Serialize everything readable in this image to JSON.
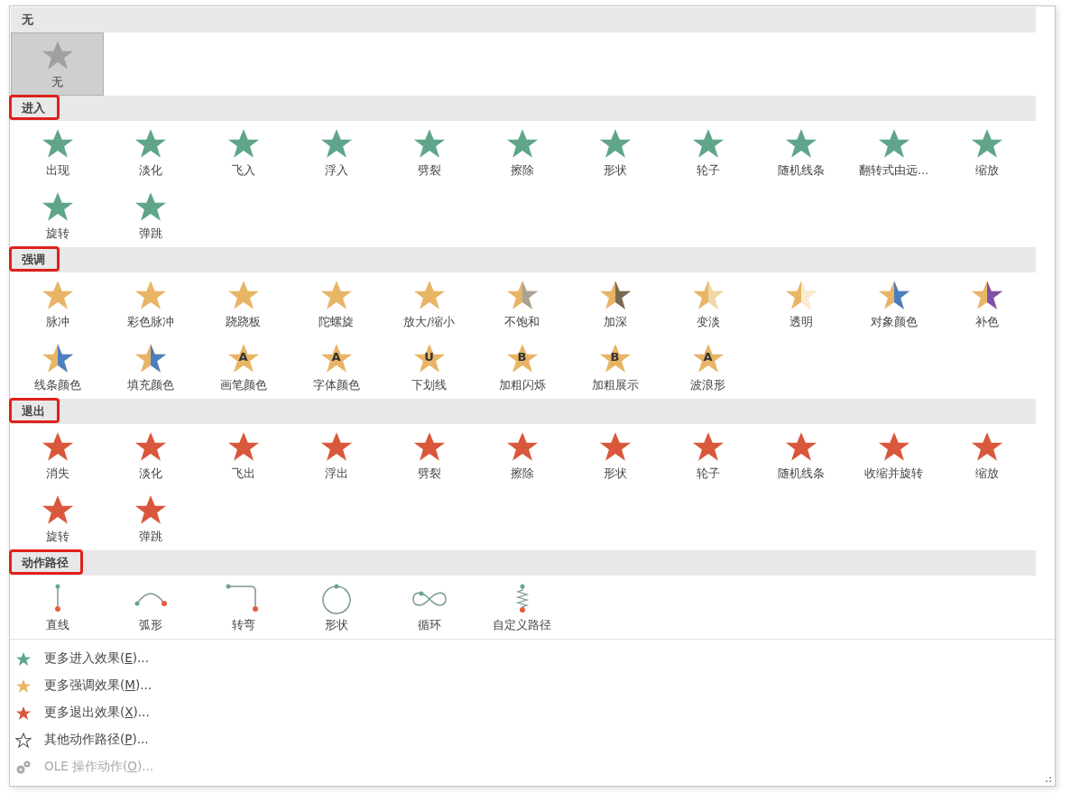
{
  "sections": [
    {
      "title": "无",
      "highlighted": false,
      "color": "#a0a0a0",
      "items": [
        {
          "label": "无",
          "kind": "star",
          "selected": true
        }
      ]
    },
    {
      "title": "进入",
      "highlighted": true,
      "color": "#5fa58a",
      "items": [
        {
          "label": "出现",
          "kind": "star",
          "selected": false
        },
        {
          "label": "淡化",
          "kind": "star",
          "selected": false
        },
        {
          "label": "飞入",
          "kind": "star",
          "selected": false
        },
        {
          "label": "浮入",
          "kind": "star",
          "selected": false
        },
        {
          "label": "劈裂",
          "kind": "star",
          "selected": false
        },
        {
          "label": "擦除",
          "kind": "star",
          "selected": false
        },
        {
          "label": "形状",
          "kind": "star",
          "selected": false
        },
        {
          "label": "轮子",
          "kind": "star",
          "selected": false
        },
        {
          "label": "随机线条",
          "kind": "star",
          "selected": false
        },
        {
          "label": "翻转式由远...",
          "kind": "star",
          "selected": false
        },
        {
          "label": "缩放",
          "kind": "star",
          "selected": false
        },
        {
          "label": "旋转",
          "kind": "star",
          "selected": false
        },
        {
          "label": "弹跳",
          "kind": "star",
          "selected": false
        }
      ]
    },
    {
      "title": "强调",
      "highlighted": true,
      "color": "#e8b566",
      "items": [
        {
          "label": "脉冲",
          "kind": "star",
          "selected": false
        },
        {
          "label": "彩色脉冲",
          "kind": "star",
          "selected": false
        },
        {
          "label": "跷跷板",
          "kind": "star",
          "selected": false
        },
        {
          "label": "陀螺旋",
          "kind": "star",
          "selected": false
        },
        {
          "label": "放大/缩小",
          "kind": "star",
          "selected": false
        },
        {
          "label": "不饱和",
          "kind": "star",
          "selected": false,
          "color": "#a9a395"
        },
        {
          "label": "加深",
          "kind": "star",
          "selected": false,
          "color": "#7a6a55"
        },
        {
          "label": "变淡",
          "kind": "star",
          "selected": false,
          "color": "#f2d7a8"
        },
        {
          "label": "透明",
          "kind": "star",
          "selected": false,
          "color": "#faebd2"
        },
        {
          "label": "对象颜色",
          "kind": "star",
          "selected": false,
          "color": "#4a7fc1"
        },
        {
          "label": "补色",
          "kind": "star",
          "selected": false,
          "color": "#7d52a8"
        },
        {
          "label": "线条颜色",
          "kind": "star",
          "selected": false,
          "color": "#4a7fc1"
        },
        {
          "label": "填充颜色",
          "kind": "star",
          "selected": false,
          "color": "#4a7fc1"
        },
        {
          "label": "画笔颜色",
          "kind": "star",
          "selected": false,
          "glyph": "A"
        },
        {
          "label": "字体颜色",
          "kind": "star",
          "selected": false,
          "glyph": "A"
        },
        {
          "label": "下划线",
          "kind": "star",
          "selected": false,
          "glyph": "U"
        },
        {
          "label": "加粗闪烁",
          "kind": "star",
          "selected": false,
          "glyph": "B"
        },
        {
          "label": "加粗展示",
          "kind": "star",
          "selected": false,
          "glyph": "B"
        },
        {
          "label": "波浪形",
          "kind": "star",
          "selected": false,
          "glyph": "A"
        }
      ]
    },
    {
      "title": "退出",
      "highlighted": true,
      "color": "#d9573a",
      "items": [
        {
          "label": "消失",
          "kind": "star",
          "selected": false
        },
        {
          "label": "淡化",
          "kind": "star",
          "selected": false
        },
        {
          "label": "飞出",
          "kind": "star",
          "selected": false
        },
        {
          "label": "浮出",
          "kind": "star",
          "selected": false
        },
        {
          "label": "劈裂",
          "kind": "star",
          "selected": false
        },
        {
          "label": "擦除",
          "kind": "star",
          "selected": false
        },
        {
          "label": "形状",
          "kind": "star",
          "selected": false
        },
        {
          "label": "轮子",
          "kind": "star",
          "selected": false
        },
        {
          "label": "随机线条",
          "kind": "star",
          "selected": false
        },
        {
          "label": "收缩并旋转",
          "kind": "star",
          "selected": false
        },
        {
          "label": "缩放",
          "kind": "star",
          "selected": false
        },
        {
          "label": "旋转",
          "kind": "star",
          "selected": false
        },
        {
          "label": "弹跳",
          "kind": "star",
          "selected": false
        }
      ]
    },
    {
      "title": "动作路径",
      "highlighted": true,
      "items": [
        {
          "label": "直线",
          "kind": "line",
          "selected": false
        },
        {
          "label": "弧形",
          "kind": "arc",
          "selected": false
        },
        {
          "label": "转弯",
          "kind": "turn",
          "selected": false
        },
        {
          "label": "形状",
          "kind": "circle",
          "selected": false
        },
        {
          "label": "循环",
          "kind": "loop",
          "selected": false
        },
        {
          "label": "自定义路径",
          "kind": "custom",
          "selected": false
        }
      ]
    }
  ],
  "menu": [
    {
      "before": "更多进入效果(",
      "key": "E",
      "after": ")...",
      "kind": "star",
      "color": "#5fa58a",
      "disabled": false
    },
    {
      "before": "更多强调效果(",
      "key": "M",
      "after": ")...",
      "kind": "star",
      "color": "#e8b566",
      "disabled": false
    },
    {
      "before": "更多退出效果(",
      "key": "X",
      "after": ")...",
      "kind": "star",
      "color": "#d9573a",
      "disabled": false
    },
    {
      "before": "其他动作路径(",
      "key": "P",
      "after": ")...",
      "kind": "outline",
      "color": "#555555",
      "disabled": false
    },
    {
      "before": "OLE 操作动作(",
      "key": "O",
      "after": ")...",
      "kind": "gear",
      "color": "#aaaaaa",
      "disabled": true
    }
  ]
}
